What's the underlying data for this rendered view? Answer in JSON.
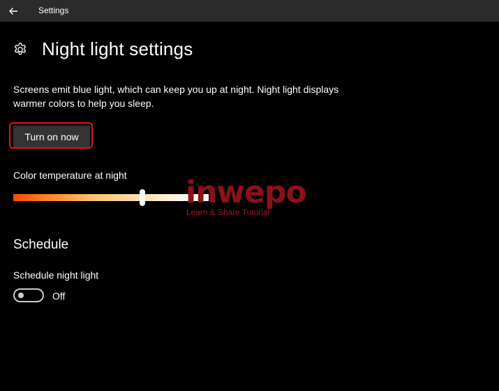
{
  "window": {
    "title": "Settings",
    "back_icon": "back-arrow-icon"
  },
  "header": {
    "icon": "gear-icon",
    "title": "Night light settings"
  },
  "description": "Screens emit blue light, which can keep you up at night. Night light displays warmer colors to help you sleep.",
  "turn_on_button": {
    "label": "Turn on now",
    "highlight_color": "#e8141b"
  },
  "color_temperature": {
    "label": "Color temperature at night",
    "value_fraction": 0.66,
    "gradient_colors": [
      "#ff4a00",
      "#ff8a2a",
      "#ffc070",
      "#ffdca0",
      "#fff2dc",
      "#ffffff"
    ]
  },
  "schedule": {
    "heading": "Schedule",
    "label": "Schedule night light",
    "toggle_state": "Off",
    "enabled": false
  },
  "watermark": {
    "word": "inwepo",
    "tagline": "Learn & Share Tutorial",
    "color": "#8c1119"
  }
}
